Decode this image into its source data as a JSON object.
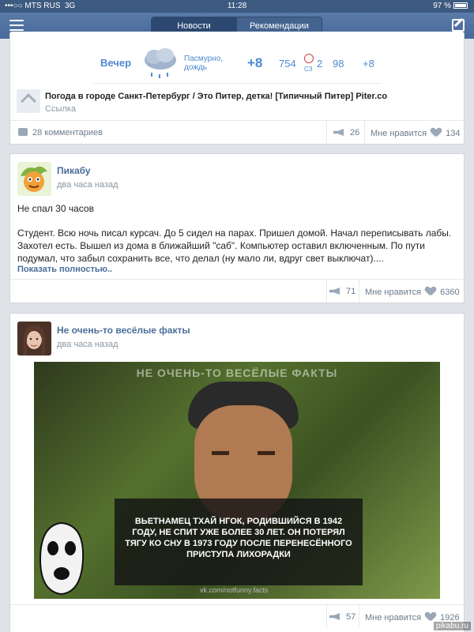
{
  "status_bar": {
    "carrier": "MTS RUS",
    "network": "3G",
    "time": "11:28",
    "battery": "97 %"
  },
  "nav": {
    "tabs": [
      "Новости",
      "Рекомендации"
    ],
    "active_tab": 0
  },
  "post1": {
    "weather": {
      "label": "Вечер",
      "condition": "Пасмурно, дождь",
      "temp": "+8",
      "pressure": "754",
      "wind": "2",
      "wind_dir": "СЗ",
      "humidity": "98",
      "feels": "+8"
    },
    "link": {
      "title": "Погода в городе Санкт-Петербург / Это Питер, детка! [Типичный Питер] Piter.co",
      "type": "Ссылка"
    },
    "comments": "28 комментариев",
    "shares": "26",
    "like_label": "Мне нравится",
    "likes": "134"
  },
  "post2": {
    "author": "Пикабу",
    "time": "два часа назад",
    "title": "Не спал 30 часов",
    "body": "Студент. Всю ночь писал курсач. До 5 сидел на парах. Пришел домой. Начал переписывать лабы. Захотел есть. Вышел из дома в ближайший \"саб\". Компьютер оставил включенным. По пути подумал, что забыл сохранить все, что делал (ну мало ли, вдруг свет выключат)....",
    "more": "Показать полностью..",
    "shares": "71",
    "like_label": "Мне нравится",
    "likes": "6360"
  },
  "post3": {
    "author": "Не очень-то весёлые факты",
    "time": "два часа назад",
    "image_header": "НЕ ОЧЕНЬ-ТО ВЕСЁЛЫЕ ФАКТЫ",
    "image_caption": "ВЬЕТНАМЕЦ ТХАЙ НГОК, РОДИВШИЙСЯ В 1942 ГОДУ, НЕ СПИТ УЖЕ БОЛЕЕ 30 ЛЕТ. ОН ПОТЕРЯЛ ТЯГУ КО СНУ В 1973 ГОДУ ПОСЛЕ ПЕРЕНЕСЁННОГО ПРИСТУПА ЛИХОРАДКИ",
    "image_source": "vk.com/notfunny.facts",
    "shares": "57",
    "like_label": "Мне нравится",
    "likes": "1926"
  },
  "watermark": "pikabu.ru"
}
